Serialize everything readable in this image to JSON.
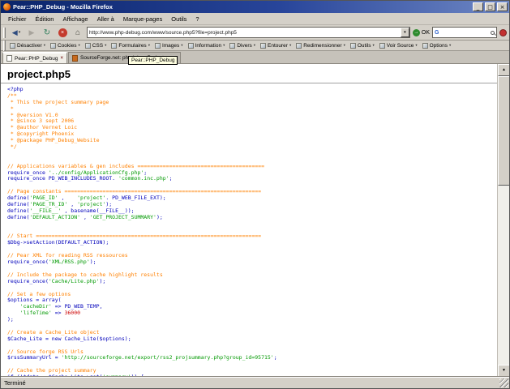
{
  "window": {
    "title": "Pear::PHP_Debug - Mozilla Firefox",
    "controls": {
      "minimize": "_",
      "maximize": "□",
      "close": "×"
    }
  },
  "icons": {
    "back": "◀",
    "forward": "▶",
    "reload": "↻",
    "stop": "×",
    "home": "⌂",
    "caret": "▾",
    "up": "▲",
    "down": "▼",
    "go": "→",
    "google": "G"
  },
  "menubar": {
    "items": [
      "Fichier",
      "Édition",
      "Affichage",
      "Aller à",
      "Marque-pages",
      "Outils",
      "?"
    ]
  },
  "navbar": {
    "url": "http://www.php-debug.com/www/source.php5?file=project.php5",
    "go_label": "OK"
  },
  "devbar": {
    "items": [
      "Désactiver",
      "Cookies",
      "CSS",
      "Formulaires",
      "Images",
      "Information",
      "Divers",
      "Entourer",
      "Redimensionner",
      "Outils",
      "Voir Source",
      "Options"
    ]
  },
  "tabbar": {
    "tabs": [
      {
        "label": "Pear::PHP_Debug"
      },
      {
        "label": "SourceForge.net: phpdebug Project: ..."
      }
    ]
  },
  "tooltip": {
    "text": "Pear::PHP_Debug"
  },
  "content": {
    "heading": "project.php5"
  },
  "statusbar": {
    "text": "Terminé"
  },
  "code": {
    "lines": [
      [
        [
          "k",
          "<?php"
        ]
      ],
      [
        [
          "c",
          "/**"
        ]
      ],
      [
        [
          "c",
          " * This the project summary page"
        ]
      ],
      [
        [
          "c",
          " *"
        ]
      ],
      [
        [
          "c",
          " * @version V1.0"
        ]
      ],
      [
        [
          "c",
          " * @since 3 sept 2006"
        ]
      ],
      [
        [
          "c",
          " * @author Vernet Loic"
        ]
      ],
      [
        [
          "c",
          " * @copyright Phoenix"
        ]
      ],
      [
        [
          "c",
          " * @package PHP_Debug_Website"
        ]
      ],
      [
        [
          "c",
          " */"
        ]
      ],
      [],
      [],
      [
        [
          "c",
          "// Applications variables & gen includes ========================================"
        ]
      ],
      [
        [
          "k",
          "require_once "
        ],
        [
          "s",
          "'../config/ApplicationCfg.php'"
        ],
        [
          "k",
          ";"
        ]
      ],
      [
        [
          "k",
          "require_once PD_WEB_INCLUDES_ROOT. "
        ],
        [
          "s",
          "'common.inc.php'"
        ],
        [
          "k",
          ";"
        ]
      ],
      [],
      [
        [
          "c",
          "// Page constants =============================================================="
        ]
      ],
      [
        [
          "k",
          "define("
        ],
        [
          "s",
          "'PAGE_ID'"
        ],
        [
          "k",
          " ,    "
        ],
        [
          "s",
          "'project'"
        ],
        [
          "k",
          ". PD_WEB_FILE_EXT);"
        ]
      ],
      [
        [
          "k",
          "define("
        ],
        [
          "s",
          "'PAGE_TR_ID'"
        ],
        [
          "k",
          " , "
        ],
        [
          "s",
          "'project'"
        ],
        [
          "k",
          ");"
        ]
      ],
      [
        [
          "k",
          "define("
        ],
        [
          "s",
          "'__FILE__'"
        ],
        [
          "k",
          " , basename(__FILE__));"
        ]
      ],
      [
        [
          "k",
          "define("
        ],
        [
          "s",
          "'DEFAULT_ACTION'"
        ],
        [
          "k",
          " , "
        ],
        [
          "s",
          "'GET_PROJECT_SUMMARY'"
        ],
        [
          "k",
          ");"
        ]
      ],
      [],
      [],
      [
        [
          "c",
          "// Start ======================================================================="
        ]
      ],
      [
        [
          "k",
          "$Dbg->setAction(DEFAULT_ACTION);"
        ]
      ],
      [],
      [
        [
          "c",
          "// Pear XML for reading RSS ressources"
        ]
      ],
      [
        [
          "k",
          "require_once("
        ],
        [
          "s",
          "'XML/RSS.php'"
        ],
        [
          "k",
          ");"
        ]
      ],
      [],
      [
        [
          "c",
          "// Include the package to cache highlight results"
        ]
      ],
      [
        [
          "k",
          "require_once("
        ],
        [
          "s",
          "'Cache/Lite.php'"
        ],
        [
          "k",
          ");"
        ]
      ],
      [],
      [
        [
          "c",
          "// Set a few options"
        ]
      ],
      [
        [
          "k",
          "$options = array("
        ]
      ],
      [
        [
          "k",
          "    "
        ],
        [
          "s",
          "'cacheDir'"
        ],
        [
          "k",
          " => PD_WEB_TEMP,"
        ]
      ],
      [
        [
          "k",
          "    "
        ],
        [
          "s",
          "'lifeTime'"
        ],
        [
          "k",
          " => "
        ],
        [
          "n",
          "36000"
        ]
      ],
      [
        [
          "k",
          ");"
        ]
      ],
      [],
      [
        [
          "c",
          "// Create a Cache_Lite object"
        ]
      ],
      [
        [
          "k",
          "$Cache_Lite = new Cache_Lite($options);"
        ]
      ],
      [],
      [
        [
          "c",
          "// Source forge RSS Urls"
        ]
      ],
      [
        [
          "k",
          "$rssSummaryUrl = "
        ],
        [
          "s",
          "'http://sourceforge.net/export/rss2_projsummary.php?group_id=95715'"
        ],
        [
          "k",
          ";"
        ]
      ],
      [],
      [
        [
          "c",
          "// Cache the project summary"
        ]
      ],
      [
        [
          "k",
          "if (!$data = $Cache_Lite->get("
        ],
        [
          "s",
          "'summary'"
        ],
        [
          "k",
          ")) {"
        ]
      ]
    ]
  }
}
